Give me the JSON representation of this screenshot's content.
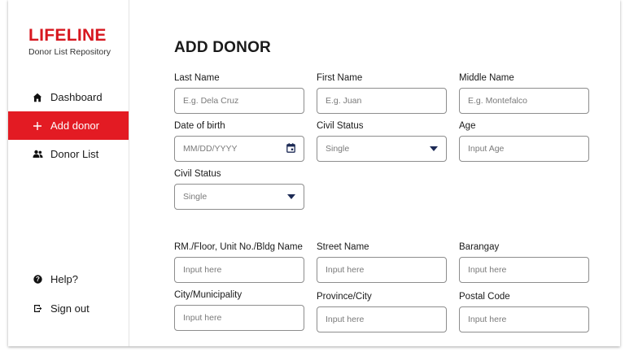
{
  "brand": {
    "title": "LIFELINE",
    "subtitle": "Donor List Repository"
  },
  "nav": {
    "dashboard": "Dashboard",
    "add_donor": "Add donor",
    "donor_list": "Donor List",
    "help": "Help?",
    "sign_out": "Sign out"
  },
  "page_title": "ADD DONOR",
  "fields": {
    "last_name": {
      "label": "Last Name",
      "placeholder": "E.g. Dela Cruz"
    },
    "first_name": {
      "label": "First Name",
      "placeholder": "E.g. Juan"
    },
    "middle_name": {
      "label": "Middle Name",
      "placeholder": "E.g. Montefalco"
    },
    "dob": {
      "label": "Date of birth",
      "placeholder": "MM/DD/YYYY"
    },
    "civil_status_1": {
      "label": "Civil Status",
      "value": "Single"
    },
    "age": {
      "label": "Age",
      "placeholder": "Input Age"
    },
    "civil_status_2": {
      "label": "Civil Status",
      "value": "Single"
    },
    "unit": {
      "label": "RM./Floor, Unit No./Bldg Name",
      "placeholder": "Input here"
    },
    "street": {
      "label": "Street Name",
      "placeholder": "Input here"
    },
    "barangay": {
      "label": "Barangay",
      "placeholder": "Input here"
    },
    "city": {
      "label": "City/Municipality",
      "placeholder": "Input here"
    },
    "province": {
      "label": "Province/City",
      "placeholder": "Input here"
    },
    "postal": {
      "label": "Postal Code",
      "placeholder": "Input here"
    }
  },
  "colors": {
    "accent": "#e31b23",
    "brand": "#d7171f",
    "dropdown_caret": "#1c2a55"
  },
  "icons": {
    "dashboard": "home-icon",
    "add_donor": "plus-icon",
    "donor_list": "users-icon",
    "help": "help-circle-icon",
    "sign_out": "sign-out-icon",
    "calendar": "calendar-icon",
    "dropdown": "chevron-down-icon"
  }
}
